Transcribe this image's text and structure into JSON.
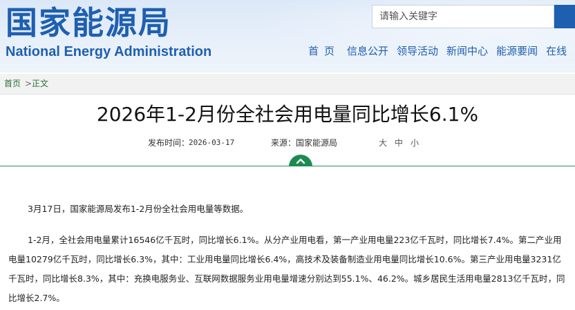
{
  "header": {
    "logo_cn": "国家能源局",
    "logo_en": "National Energy Administration",
    "search_placeholder": "请输入关键字",
    "nav": [
      "首页",
      "信息公开",
      "领导活动",
      "新闻中心",
      "能源要闻",
      "在线"
    ],
    "brand_color": "#1e5fb0"
  },
  "breadcrumb": {
    "home": "首页",
    "separator": ">",
    "current": "正文"
  },
  "article": {
    "title": "2026年1-2月份全社会用电量同比增长6.1%",
    "date_label": "发布时间：",
    "date": "2026-03-17",
    "source_label": "来源：",
    "source": "国家能源局",
    "font_size_options": [
      "大",
      "中",
      "小"
    ],
    "paragraphs": [
      "3月17日，国家能源局发布1-2月份全社会用电量等数据。",
      "1-2月，全社会用电量累计16546亿千瓦时，同比增长6.1%。从分产业用电看，第一产业用电量223亿千瓦时，同比增长7.4%。第二产业用电量10279亿千瓦时，同比增长6.3%，其中：工业用电量同比增长6.4%，高技术及装备制造业用电量同比增长10.6%。第三产业用电量3231亿千瓦时，同比增长8.3%，其中：充换电服务业、互联网数据服务业用电量增速分别达到55.1%、46.2%。城乡居民生活用电量2813亿千瓦时，同比增长2.7%。"
    ]
  },
  "icons": {
    "search": "search-icon",
    "collapse": "chevron-up-icon"
  },
  "accent_green": "#1d8a52"
}
